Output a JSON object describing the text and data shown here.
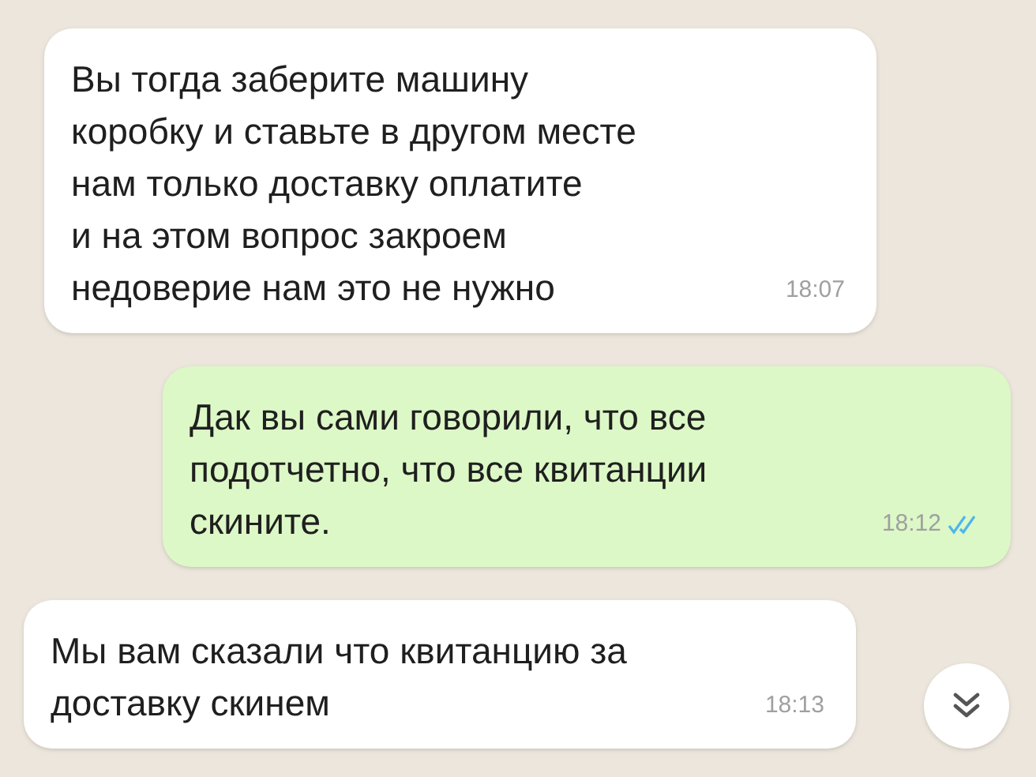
{
  "messages": [
    {
      "kind": "incoming",
      "text": "Вы тогда заберите машину\nкоробку и ставьте в другом месте\nнам только доставку оплатите\nи на этом вопрос закроем\nнедоверие нам это не нужно",
      "time": "18:07"
    },
    {
      "kind": "outgoing",
      "text": "Дак вы сами говорили, что все\nподотчетно, что все квитанции\nскините.",
      "time": "18:12",
      "read": true
    },
    {
      "kind": "incoming",
      "text": "Мы вам сказали что квитанцию за\nдоставку скинем",
      "time": "18:13"
    }
  ]
}
